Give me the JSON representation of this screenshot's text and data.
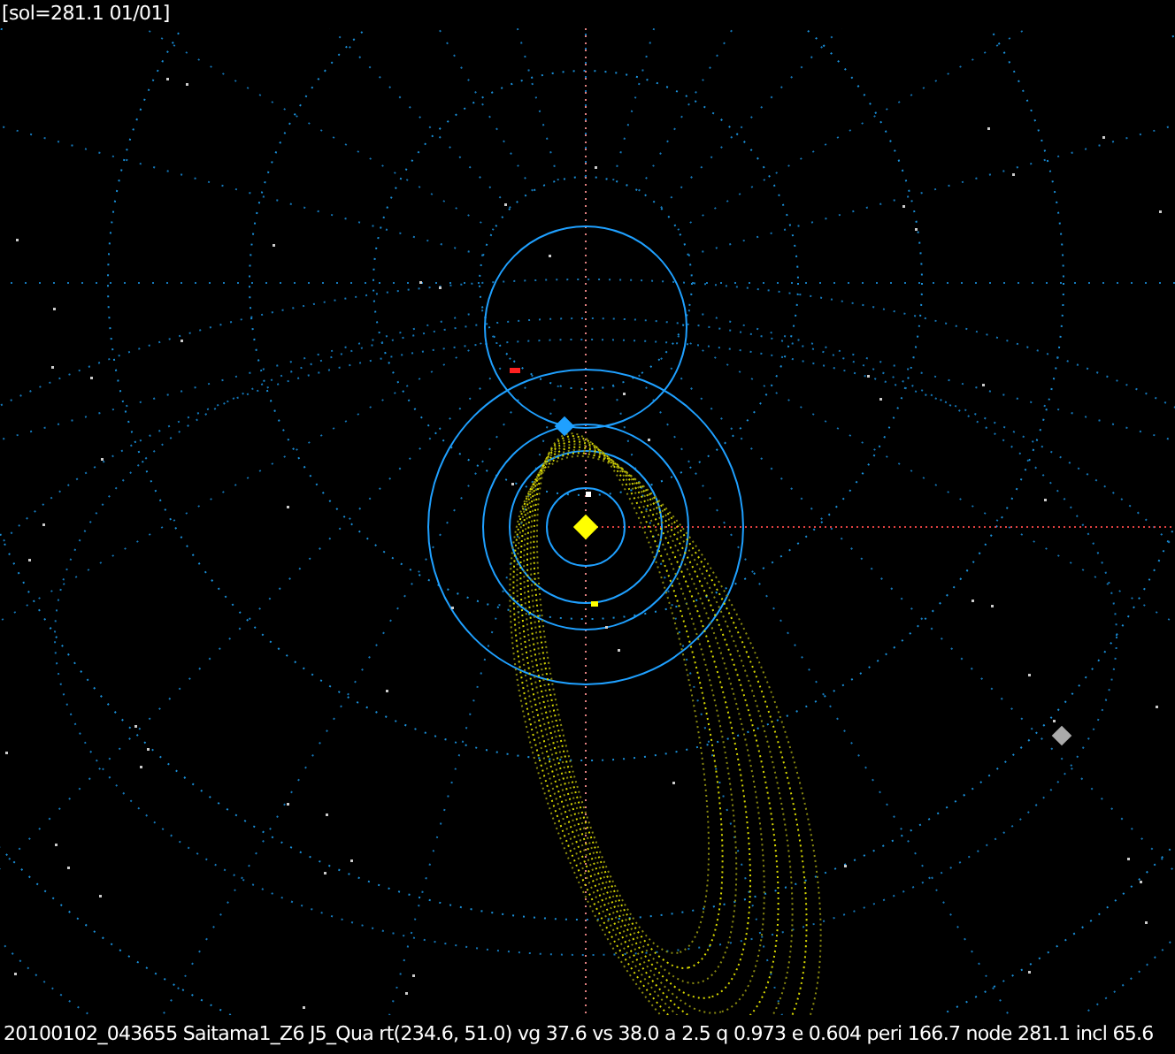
{
  "header": {
    "text": "[sol=281.1 01/01]"
  },
  "footer": {
    "text": "20100102_043655 Saitama1_Z6  J5_Qua rt(234.6, 51.0) vg 37.6 vs 38.0 a 2.5 q 0.973 e 0.604 peri 166.7 node 281.1 incl 65.6"
  }
}
